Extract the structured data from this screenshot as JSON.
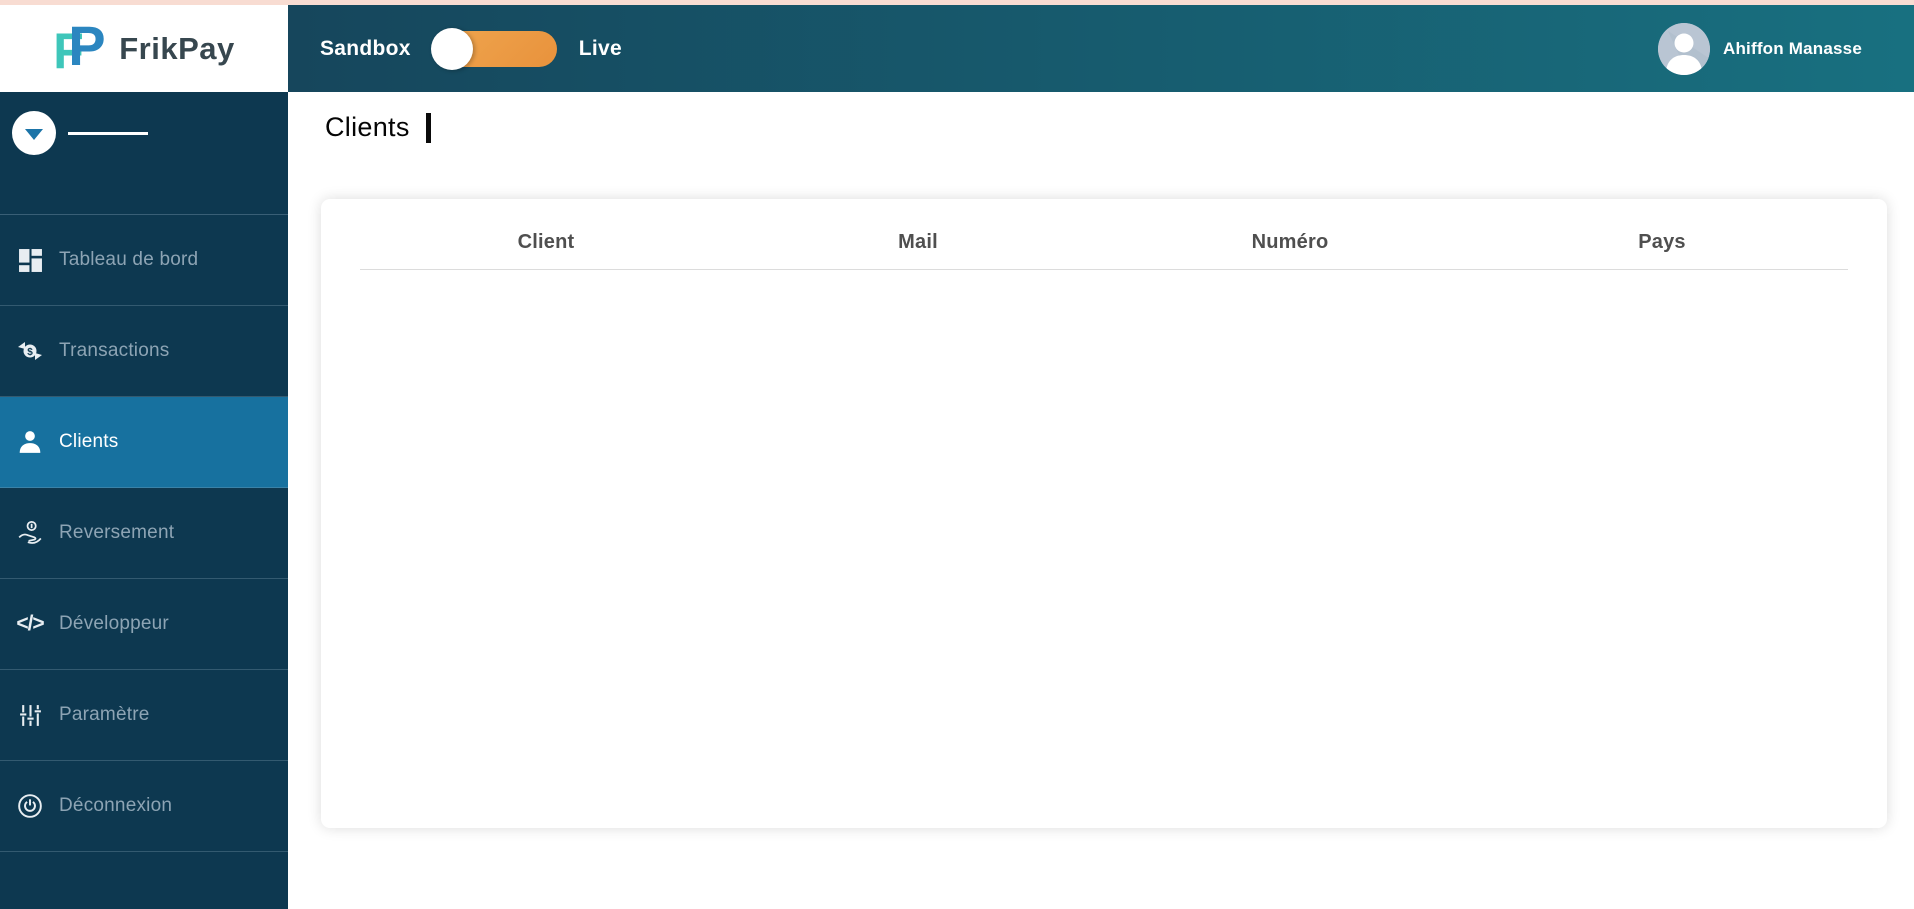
{
  "brand": {
    "name": "FrikPay",
    "logo_letter_f": "F",
    "logo_letter_p": "P"
  },
  "topbar": {
    "sandbox_label": "Sandbox",
    "live_label": "Live",
    "toggle_state": "sandbox",
    "user_name": "Ahiffon Manasse"
  },
  "sidebar": {
    "items": [
      {
        "label": "Tableau de bord",
        "icon": "dashboard-icon",
        "active": false
      },
      {
        "label": "Transactions",
        "icon": "transactions-icon",
        "active": false
      },
      {
        "label": "Clients",
        "icon": "clients-icon",
        "active": true
      },
      {
        "label": "Reversement",
        "icon": "payout-icon",
        "active": false
      },
      {
        "label": "Développeur",
        "icon": "developer-icon",
        "active": false
      },
      {
        "label": "Paramètre",
        "icon": "settings-icon",
        "active": false
      },
      {
        "label": "Déconnexion",
        "icon": "logout-icon",
        "active": false
      }
    ]
  },
  "icons": {
    "developer_glyph": "</>"
  },
  "main": {
    "title": "Clients",
    "table": {
      "columns": [
        "Client",
        "Mail",
        "Numéro",
        "Pays"
      ],
      "rows": []
    }
  },
  "colors": {
    "top_strip_pink": "#f8dcd2",
    "sidebar_navy": "#0d3850",
    "topbar_teal_start": "#16465c",
    "topbar_teal_end": "#187080",
    "active_item_blue": "#17719f",
    "toggle_orange": "#ec9c44",
    "logo_teal": "#3ec6ba",
    "logo_blue": "#2b86c0",
    "brand_text": "#37474f"
  }
}
